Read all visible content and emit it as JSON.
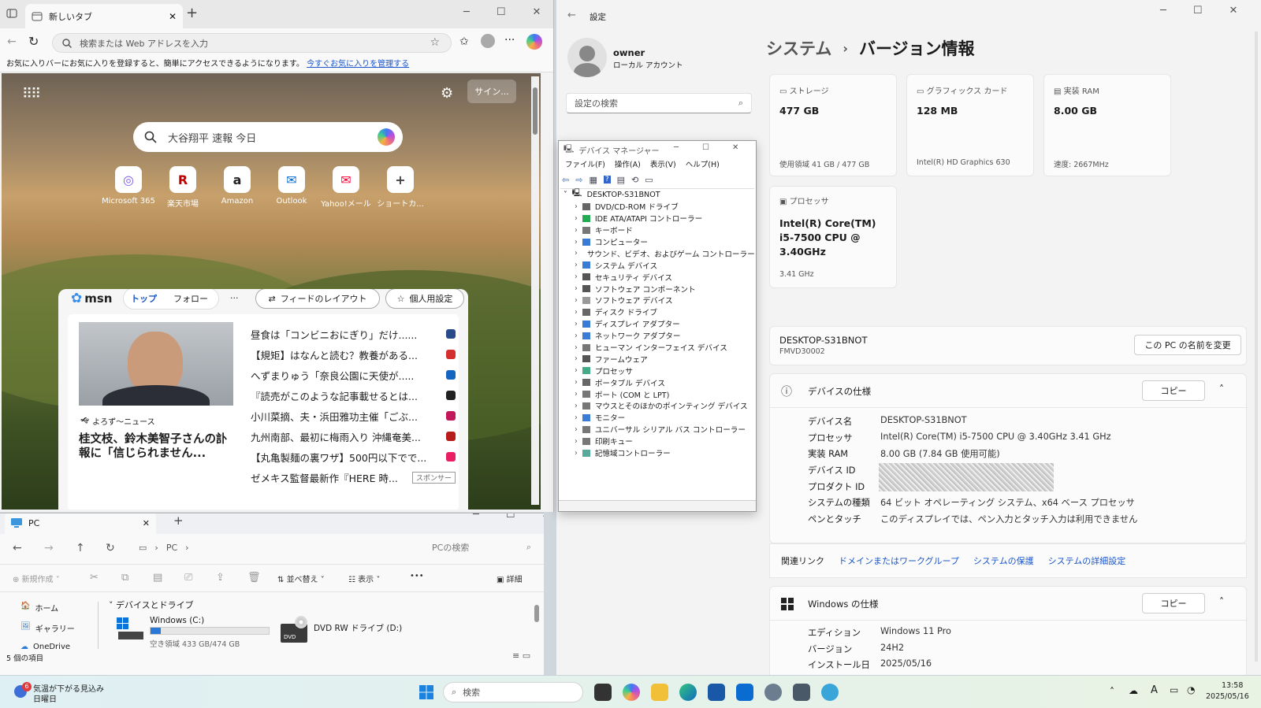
{
  "edge": {
    "tab_title": "新しいタブ",
    "address_placeholder": "検索または Web アドレスを入力",
    "favbar_text": "お気に入りバーにお気に入りを登録すると、簡単にアクセスできるようになります。",
    "favbar_link": "今すぐお気に入りを管理する",
    "signin": "サイン...",
    "search_text": "大谷翔平 速報 今日",
    "quick_links": [
      {
        "label": "Microsoft 365",
        "glyph": "◎",
        "color": "#7b5ce6"
      },
      {
        "label": "楽天市場",
        "glyph": "R",
        "color": "#bf0000"
      },
      {
        "label": "Amazon",
        "glyph": "a",
        "color": "#222"
      },
      {
        "label": "Outlook",
        "glyph": "✉",
        "color": "#0a6cd1"
      },
      {
        "label": "Yahoo!メール",
        "glyph": "✉",
        "color": "#ff0033"
      },
      {
        "label": "ショートカ...",
        "glyph": "+",
        "color": "#444"
      }
    ],
    "msn": {
      "logo": "msn",
      "tab_top": "トップ",
      "tab_follow": "フォロー",
      "more": "...",
      "layout_btn": "フィードのレイアウト",
      "personal_btn": "個人用設定",
      "source": "よろず〜ニュース",
      "headline": "桂文枝、鈴木美智子さんの訃報に「信じられません...",
      "news": [
        {
          "text": "昼食は「コンビニおにぎり」だけ......",
          "color": "#2b4a8c"
        },
        {
          "text": "【規矩】はなんと読む？教養がある...",
          "color": "#d32f2f"
        },
        {
          "text": "へずまりゅう「奈良公園に天使が.....",
          "color": "#1565c0"
        },
        {
          "text": "『読売がこのような記事載せるとは...",
          "color": "#222"
        },
        {
          "text": "小川菜摘、夫・浜田雅功主催「ごぶ...",
          "color": "#c2185b"
        },
        {
          "text": "九州南部、最初に梅雨入り 沖縄奄美...",
          "color": "#b71c1c"
        },
        {
          "text": "【丸亀製麺の裏ワザ】500円以下でで...",
          "color": "#e91e63"
        },
        {
          "text": "ゼメキス監督最新作『HERE 時...",
          "color": "#888"
        }
      ],
      "sponsor": "スポンサー"
    }
  },
  "explorer": {
    "tab_title": "PC",
    "breadcrumb": "PC",
    "search_placeholder": "PCの検索",
    "new_btn": "新規作成",
    "sort_btn": "並べ替え",
    "view_btn": "表示",
    "more": "•••",
    "details_btn": "詳細",
    "nav": [
      "ホーム",
      "ギャラリー",
      "OneDrive"
    ],
    "section": "デバイスとドライブ",
    "drive_c_name": "Windows (C:)",
    "drive_c_free": "空き領域 433 GB/474 GB",
    "drive_c_used_fraction": 0.087,
    "drive_d_name": "DVD RW ドライブ (D:)",
    "dvd_label": "DVD",
    "status": "5 個の項目"
  },
  "devmgr": {
    "title": "デバイス マネージャー",
    "menus": [
      "ファイル(F)",
      "操作(A)",
      "表示(V)",
      "ヘルプ(H)"
    ],
    "root": "DESKTOP-S31BNOT",
    "items": [
      "DVD/CD-ROM ドライブ",
      "IDE ATA/ATAPI コントローラー",
      "キーボード",
      "コンピューター",
      "サウンド、ビデオ、およびゲーム コントローラー",
      "システム デバイス",
      "セキュリティ デバイス",
      "ソフトウェア コンポーネント",
      "ソフトウェア デバイス",
      "ディスク ドライブ",
      "ディスプレイ アダプター",
      "ネットワーク アダプター",
      "ヒューマン インターフェイス デバイス",
      "ファームウェア",
      "プロセッサ",
      "ポータブル デバイス",
      "ポート (COM と LPT)",
      "マウスとそのほかのポインティング デバイス",
      "モニター",
      "ユニバーサル シリアル バス コントローラー",
      "印刷キュー",
      "記憶域コントローラー"
    ]
  },
  "settings": {
    "app_title": "設定",
    "user": "owner",
    "account_type": "ローカル アカウント",
    "search_placeholder": "設定の検索",
    "breadcrumb_parent": "システム",
    "breadcrumb_sep": "›",
    "breadcrumb_current": "バージョン情報",
    "cards": [
      {
        "label": "ストレージ",
        "value": "477 GB",
        "sub": "使用領域 41 GB / 477 GB"
      },
      {
        "label": "グラフィックス カード",
        "value": "128 MB",
        "sub": "Intel(R) HD Graphics 630"
      },
      {
        "label": "実装 RAM",
        "value": "8.00 GB",
        "sub": "速度: 2667MHz"
      }
    ],
    "cpu_label": "プロセッサ",
    "cpu_value_lines": [
      "Intel(R) Core(TM)",
      "i5-7500 CPU @",
      "3.40GHz"
    ],
    "cpu_sub": "3.41 GHz",
    "pc_name": "DESKTOP-S31BNOT",
    "pc_model": "FMVD30002",
    "rename_btn": "この PC の名前を変更",
    "device_spec_title": "デバイスの仕様",
    "copy_btn": "コピー",
    "device_specs": [
      {
        "k": "デバイス名",
        "v": "DESKTOP-S31BNOT"
      },
      {
        "k": "プロセッサ",
        "v": "Intel(R) Core(TM) i5-7500 CPU @ 3.40GHz   3.41 GHz"
      },
      {
        "k": "実装 RAM",
        "v": "8.00 GB (7.84 GB 使用可能)"
      },
      {
        "k": "デバイス ID",
        "v": ""
      },
      {
        "k": "プロダクト ID",
        "v": ""
      },
      {
        "k": "システムの種類",
        "v": "64 ビット オペレーティング システム、x64 ベース プロセッサ"
      },
      {
        "k": "ペンとタッチ",
        "v": "このディスプレイでは、ペン入力とタッチ入力は利用できません"
      }
    ],
    "related_label": "関連リンク",
    "related_links": [
      "ドメインまたはワークグループ",
      "システムの保護",
      "システムの詳細設定"
    ],
    "windows_spec_title": "Windows の仕様",
    "windows_specs": [
      {
        "k": "エディション",
        "v": "Windows 11 Pro"
      },
      {
        "k": "バージョン",
        "v": "24H2"
      },
      {
        "k": "インストール日",
        "v": "2025/05/16"
      }
    ]
  },
  "taskbar": {
    "weather_badge": "6",
    "weather_text": "気温が下がる見込み",
    "weather_sub": "日曜日",
    "search_placeholder": "検索",
    "ime": "A",
    "time": "13:58",
    "date": "2025/05/16"
  }
}
